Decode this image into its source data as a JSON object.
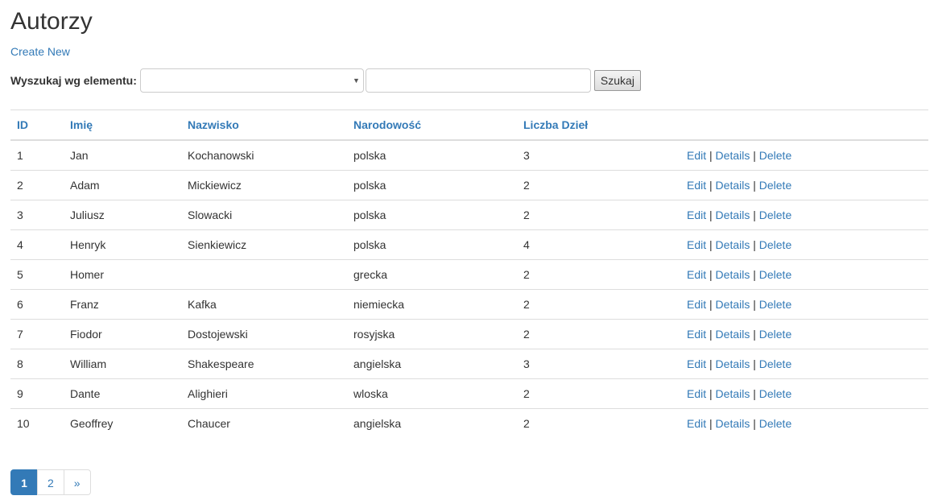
{
  "page": {
    "title": "Autorzy",
    "create_new": "Create New"
  },
  "search": {
    "label": "Wyszukaj wg elementu:",
    "select_value": "",
    "text_value": "",
    "button_label": "Szukaj"
  },
  "table": {
    "headers": {
      "id": "ID",
      "first_name": "Imię",
      "last_name": "Nazwisko",
      "nationality": "Narodowość",
      "works": "Liczba Dzieł"
    },
    "actions": {
      "edit": "Edit",
      "details": "Details",
      "delete": "Delete",
      "separator": "|"
    },
    "rows": [
      {
        "id": "1",
        "first_name": "Jan",
        "last_name": "Kochanowski",
        "nationality": "polska",
        "works": "3"
      },
      {
        "id": "2",
        "first_name": "Adam",
        "last_name": "Mickiewicz",
        "nationality": "polska",
        "works": "2"
      },
      {
        "id": "3",
        "first_name": "Juliusz",
        "last_name": "Slowacki",
        "nationality": "polska",
        "works": "2"
      },
      {
        "id": "4",
        "first_name": "Henryk",
        "last_name": "Sienkiewicz",
        "nationality": "polska",
        "works": "4"
      },
      {
        "id": "5",
        "first_name": "Homer",
        "last_name": "",
        "nationality": "grecka",
        "works": "2"
      },
      {
        "id": "6",
        "first_name": "Franz",
        "last_name": "Kafka",
        "nationality": "niemiecka",
        "works": "2"
      },
      {
        "id": "7",
        "first_name": "Fiodor",
        "last_name": "Dostojewski",
        "nationality": "rosyjska",
        "works": "2"
      },
      {
        "id": "8",
        "first_name": "William",
        "last_name": "Shakespeare",
        "nationality": "angielska",
        "works": "3"
      },
      {
        "id": "9",
        "first_name": "Dante",
        "last_name": "Alighieri",
        "nationality": "wloska",
        "works": "2"
      },
      {
        "id": "10",
        "first_name": "Geoffrey",
        "last_name": "Chaucer",
        "nationality": "angielska",
        "works": "2"
      }
    ]
  },
  "pagination": {
    "pages": [
      "1",
      "2"
    ],
    "next": "»",
    "current": "1"
  },
  "colors": {
    "link": "#337ab7",
    "text": "#333333",
    "border": "#dddddd",
    "active_page_bg": "#337ab7"
  },
  "icons": {
    "select_dropdown": "chevron-down-icon"
  }
}
